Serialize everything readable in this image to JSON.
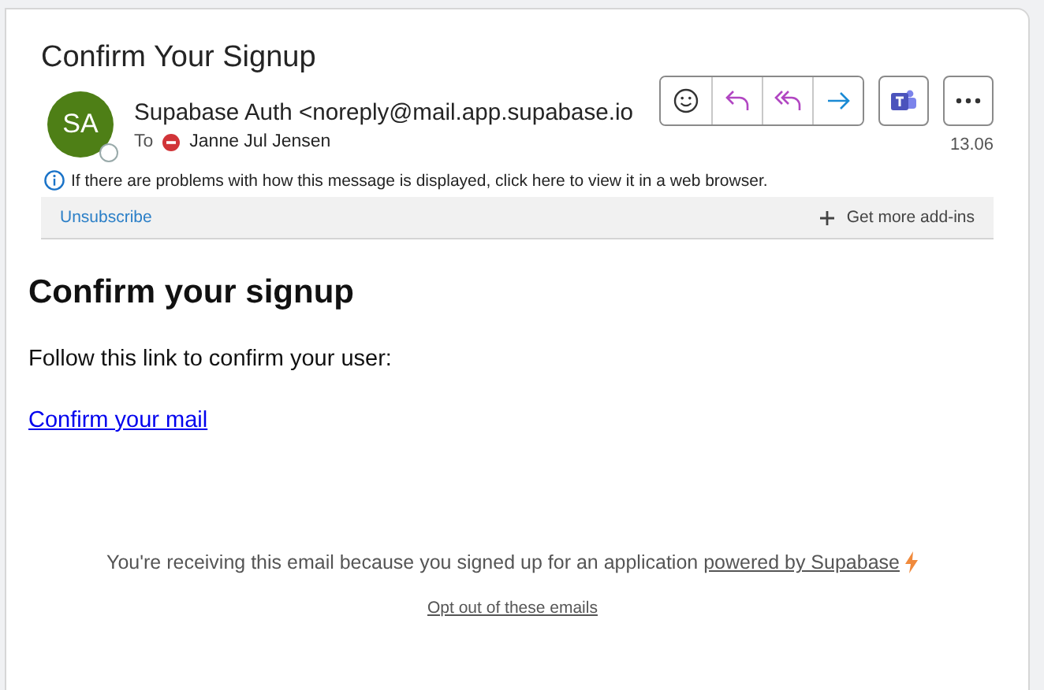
{
  "message": {
    "subject": "Confirm Your Signup",
    "avatar_initials": "SA",
    "sender": "Supabase Auth <noreply@mail.app.supabase.io",
    "to_label": "To",
    "recipient": "Janne Jul Jensen",
    "date": "13.06",
    "info": "If there are problems with how this message is displayed, click here to view it in a web browser.",
    "unsubscribe": "Unsubscribe",
    "add_ins": "Get more add-ins"
  },
  "toolbar": [
    {
      "kind": "emoji"
    },
    {
      "kind": "reply"
    },
    {
      "kind": "reply_all"
    },
    {
      "kind": "forward"
    }
  ],
  "body": {
    "heading": "Confirm your signup",
    "paragraph": "Follow this link to confirm your user:",
    "link": "Confirm your mail"
  },
  "footer": {
    "text": "You're receiving this email because you signed up for an application ",
    "link": "powered by Supabase",
    "opt_out": "Opt out of these emails"
  }
}
